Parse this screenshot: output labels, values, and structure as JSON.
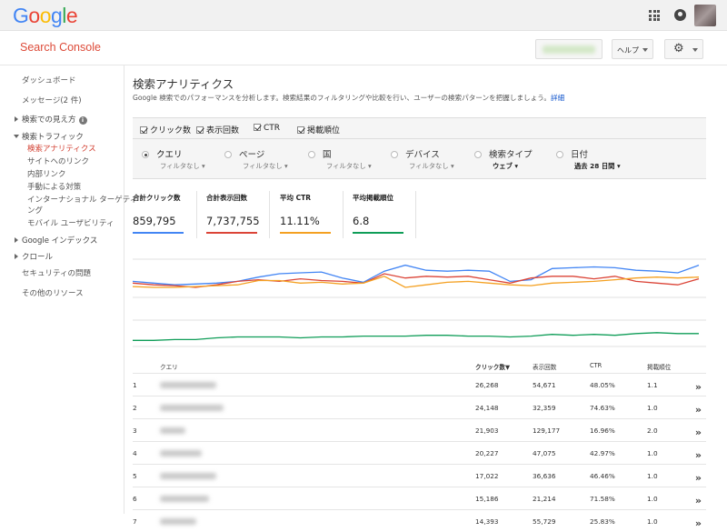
{
  "header": {
    "logo": "Google",
    "logo_colors": [
      "#4285f4",
      "#ea4335",
      "#fbbc05",
      "#4285f4",
      "#34a853",
      "#ea4335"
    ],
    "product": "Search Console",
    "help_label": "ヘルプ",
    "gear_icon": "gear-icon"
  },
  "sidebar": {
    "items": [
      {
        "label": "ダッシュボード"
      },
      {
        "label": "メッセージ(2 件)"
      },
      {
        "label": "検索での見え方"
      },
      {
        "label": "検索トラフィック"
      },
      {
        "label": "検索アナリティクス"
      },
      {
        "label": "サイトへのリンク"
      },
      {
        "label": "内部リンク"
      },
      {
        "label": "手動による対策"
      },
      {
        "label": "インターナショナル ターゲティ"
      },
      {
        "label": "ング"
      },
      {
        "label": "モバイル ユーザビリティ"
      },
      {
        "label": "Google インデックス"
      },
      {
        "label": "クロール"
      },
      {
        "label": "セキュリティの問題"
      },
      {
        "label": "その他のリソース"
      }
    ]
  },
  "page": {
    "title": "検索アナリティクス",
    "description": "Google 検索でのパフォーマンスを分析します。検索結果のフィルタリングや比較を行い、ユーザーの検索パターンを把握しましょう。",
    "description_link": "詳細"
  },
  "checks": [
    {
      "label": "クリック数",
      "checked": true
    },
    {
      "label": "表示回数",
      "checked": true
    },
    {
      "label": "CTR",
      "checked": true
    },
    {
      "label": "掲載順位",
      "checked": true
    }
  ],
  "dimensions": [
    {
      "label": "クエリ",
      "filter": "フィルタなし",
      "selected": true
    },
    {
      "label": "ページ",
      "filter": "フィルタなし",
      "selected": false
    },
    {
      "label": "国",
      "filter": "フィルタなし",
      "selected": false
    },
    {
      "label": "デバイス",
      "filter": "フィルタなし",
      "selected": false
    },
    {
      "label": "検索タイプ",
      "filter": "ウェブ",
      "selected": false
    },
    {
      "label": "日付",
      "filter": "過去 28 日間",
      "selected": false
    }
  ],
  "metrics": [
    {
      "label": "合計クリック数",
      "value": "859,795",
      "color": "#4285f4"
    },
    {
      "label": "合計表示回数",
      "value": "7,737,755",
      "color": "#db4437"
    },
    {
      "label": "平均 CTR",
      "value": "11.11%",
      "color": "#f4a021"
    },
    {
      "label": "平均掲載順位",
      "value": "6.8",
      "color": "#0f9d58"
    }
  ],
  "chart_data": {
    "type": "line",
    "x": [
      1,
      2,
      3,
      4,
      5,
      6,
      7,
      8,
      9,
      10,
      11,
      12,
      13,
      14,
      15,
      16,
      17,
      18,
      19,
      20,
      21,
      22,
      23,
      24,
      25,
      26,
      27,
      28
    ],
    "series": [
      {
        "color": "#4285f4",
        "values": [
          0.74,
          0.72,
          0.7,
          0.71,
          0.72,
          0.74,
          0.79,
          0.83,
          0.84,
          0.85,
          0.78,
          0.73,
          0.86,
          0.93,
          0.87,
          0.86,
          0.87,
          0.86,
          0.74,
          0.76,
          0.89,
          0.9,
          0.91,
          0.9,
          0.87,
          0.86,
          0.84,
          0.93
        ]
      },
      {
        "color": "#db4437",
        "values": [
          0.72,
          0.7,
          0.69,
          0.67,
          0.7,
          0.74,
          0.76,
          0.74,
          0.77,
          0.75,
          0.74,
          0.72,
          0.83,
          0.78,
          0.8,
          0.79,
          0.8,
          0.76,
          0.72,
          0.78,
          0.8,
          0.8,
          0.77,
          0.8,
          0.74,
          0.72,
          0.7,
          0.77
        ]
      },
      {
        "color": "#f4a021",
        "values": [
          0.68,
          0.67,
          0.67,
          0.68,
          0.69,
          0.7,
          0.75,
          0.75,
          0.72,
          0.73,
          0.71,
          0.72,
          0.8,
          0.67,
          0.7,
          0.73,
          0.74,
          0.72,
          0.7,
          0.69,
          0.72,
          0.73,
          0.74,
          0.76,
          0.78,
          0.79,
          0.78,
          0.79
        ]
      },
      {
        "color": "#0f9d58",
        "values": [
          0.05,
          0.05,
          0.06,
          0.06,
          0.08,
          0.09,
          0.09,
          0.09,
          0.08,
          0.09,
          0.09,
          0.1,
          0.1,
          0.1,
          0.11,
          0.11,
          0.1,
          0.1,
          0.09,
          0.1,
          0.12,
          0.11,
          0.12,
          0.11,
          0.13,
          0.14,
          0.13,
          0.13
        ]
      }
    ]
  },
  "table": {
    "columns": [
      "クエリ",
      "クリック数▼",
      "表示回数",
      "CTR",
      "掲載順位"
    ],
    "rows": [
      {
        "n": "1",
        "clicks": "26,268",
        "impr": "54,671",
        "ctr": "48.05%",
        "pos": "1.1"
      },
      {
        "n": "2",
        "clicks": "24,148",
        "impr": "32,359",
        "ctr": "74.63%",
        "pos": "1.0"
      },
      {
        "n": "3",
        "clicks": "21,903",
        "impr": "129,177",
        "ctr": "16.96%",
        "pos": "2.0"
      },
      {
        "n": "4",
        "clicks": "20,227",
        "impr": "47,075",
        "ctr": "42.97%",
        "pos": "1.0"
      },
      {
        "n": "5",
        "clicks": "17,022",
        "impr": "36,636",
        "ctr": "46.46%",
        "pos": "1.0"
      },
      {
        "n": "6",
        "clicks": "15,186",
        "impr": "21,214",
        "ctr": "71.58%",
        "pos": "1.0"
      },
      {
        "n": "7",
        "clicks": "14,393",
        "impr": "55,729",
        "ctr": "25.83%",
        "pos": "1.0"
      }
    ],
    "go_label": "»"
  }
}
